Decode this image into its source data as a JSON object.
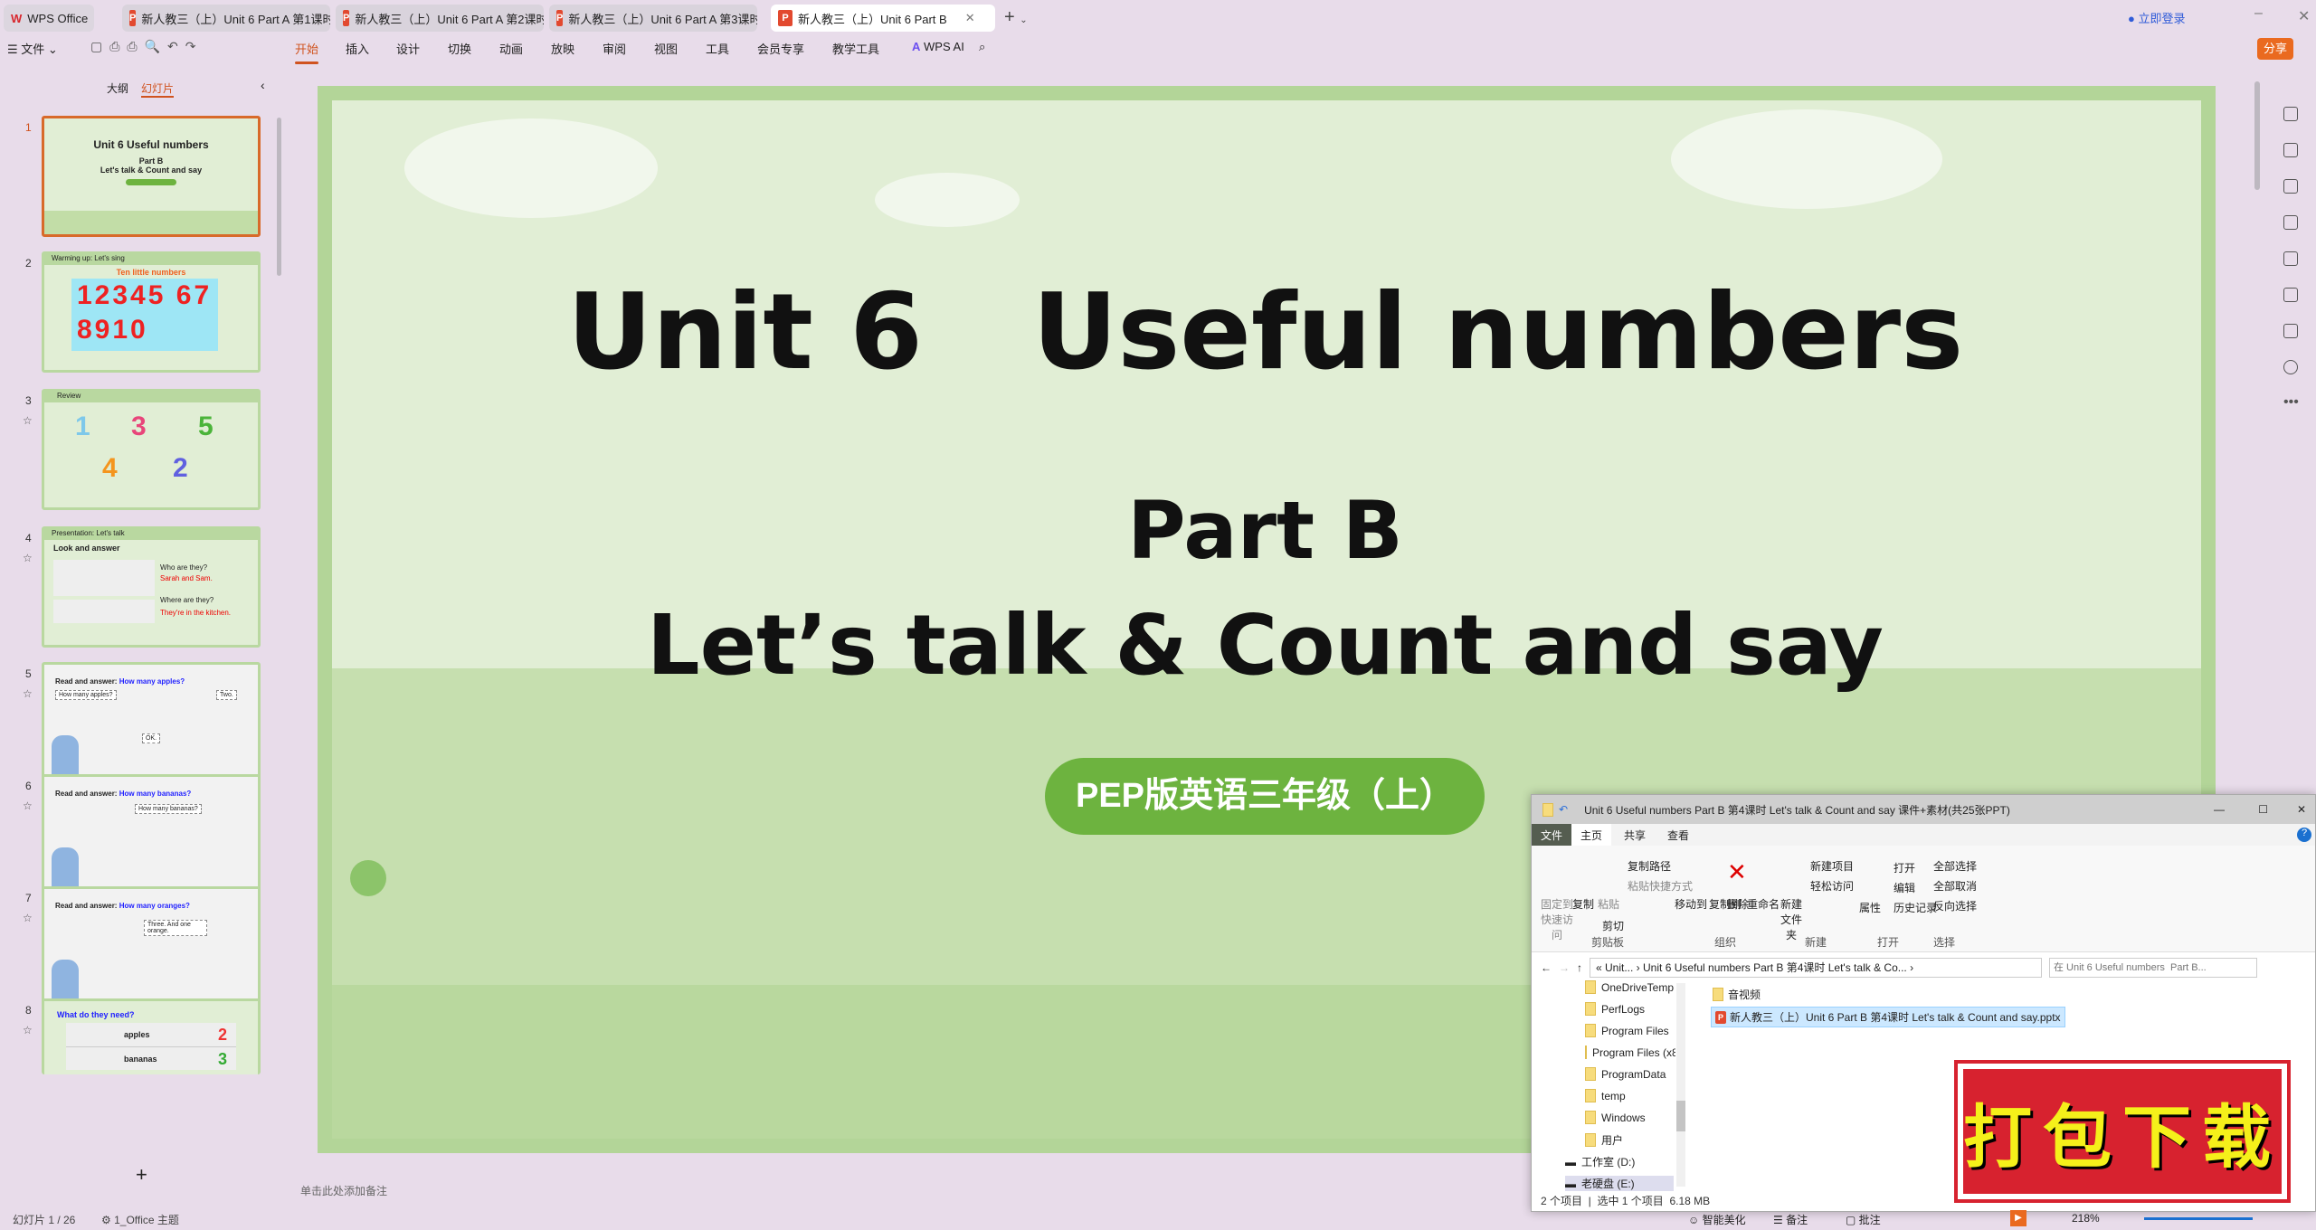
{
  "tabs": [
    {
      "label": "WPS Office"
    },
    {
      "label": "新人教三（上）Unit 6 Part A 第1课时"
    },
    {
      "label": "新人教三（上）Unit 6 Part A 第2课时"
    },
    {
      "label": "新人教三（上）Unit 6 Part A 第3课时"
    },
    {
      "label": "新人教三（上）Unit 6 Part B"
    }
  ],
  "titlebar": {
    "login": "立即登录",
    "share": "分享"
  },
  "menu": {
    "file": "文件",
    "items": [
      "开始",
      "插入",
      "设计",
      "切换",
      "动画",
      "放映",
      "审阅",
      "视图",
      "工具",
      "会员专享",
      "教学工具"
    ],
    "ai": "WPS AI",
    "active": "开始"
  },
  "panel": {
    "outline": "大纲",
    "slides": "幻灯片"
  },
  "thumbnails": [
    {
      "num": "1",
      "title": "Unit 6  Useful numbers",
      "sub1": "Part B",
      "sub2": "Let's talk & Count and say"
    },
    {
      "num": "2",
      "header": "Warming up: Let's sing",
      "title": "Ten little numbers",
      "digits": "12345 678910"
    },
    {
      "num": "3",
      "header": "Review",
      "digits": [
        "1",
        "3",
        "5",
        "4",
        "2"
      ]
    },
    {
      "num": "4",
      "header": "Presentation: Let's talk",
      "title": "Look and answer",
      "q1": "Who are they?",
      "a1": "Sarah and Sam.",
      "q2": "Where are they?",
      "a2": "They're in the kitchen."
    },
    {
      "num": "5",
      "title": "Read and answer:",
      "q": "How many apples?"
    },
    {
      "num": "6",
      "title": "Read and answer:",
      "q": "How many bananas?"
    },
    {
      "num": "7",
      "title": "Read and answer:",
      "q": "How many oranges?"
    },
    {
      "num": "8",
      "title": "What do they need?",
      "rows": [
        {
          "item": "apples",
          "n": "2"
        },
        {
          "item": "bananas",
          "n": "3"
        }
      ]
    }
  ],
  "bubbles": {
    "b1": "How many apples?",
    "b2": "Two.",
    "b3": "How many bananas?",
    "b4": "Three. And one orange.",
    "b5": "OK."
  },
  "slide": {
    "title": "Unit 6   Useful numbers",
    "part": "Part B",
    "subtitle": "Let’s talk & Count and say",
    "badge": "PEP版英语三年级（上）"
  },
  "notes_placeholder": "单击此处添加备注",
  "status": {
    "slide": "幻灯片 1 / 26",
    "theme": "1_Office 主题",
    "beautify": "智能美化",
    "notes": "备注",
    "comments": "批注",
    "zoom": "218%"
  },
  "explorer": {
    "title": "Unit 6 Useful numbers  Part B 第4课时 Let's talk & Count and say 课件+素材(共25张PPT)",
    "tabs": [
      "文件",
      "主页",
      "共享",
      "查看"
    ],
    "ribbon": {
      "clipboard": {
        "label": "剪贴板",
        "pin": "固定到快速访问",
        "copy": "复制",
        "paste": "粘贴",
        "copy_path": "复制路径",
        "paste_shortcut": "粘贴快捷方式",
        "cut": "剪切"
      },
      "organize": {
        "label": "组织",
        "move": "移动到",
        "copyto": "复制到",
        "delete": "删除",
        "rename": "重命名"
      },
      "new": {
        "label": "新建",
        "folder": "新建文件夹",
        "item": "新建项目",
        "easy": "轻松访问"
      },
      "open": {
        "label": "打开",
        "props": "属性",
        "open": "打开",
        "edit": "编辑",
        "history": "历史记录"
      },
      "select": {
        "label": "选择",
        "all": "全部选择",
        "none": "全部取消",
        "invert": "反向选择"
      }
    },
    "address": "«  Unit...  ›  Unit 6 Useful numbers  Part B 第4课时 Let's talk & Co...  ›",
    "search_placeholder": "在 Unit 6 Useful numbers  Part B...",
    "tree": [
      "OneDriveTemp",
      "PerfLogs",
      "Program Files",
      "Program Files (x86)",
      "ProgramData",
      "temp",
      "Windows",
      "用户",
      "工作室 (D:)",
      "老硬盘 (E:)"
    ],
    "files": [
      {
        "name": "音视频",
        "type": "folder"
      },
      {
        "name": "新人教三（上）Unit 6 Part B 第4课时 Let's talk & Count and say.pptx",
        "type": "pptx",
        "selected": true
      }
    ],
    "status": {
      "count": "2 个项目",
      "selected": "选中 1 个项目",
      "size": "6.18 MB"
    }
  },
  "stamp": {
    "text": "打包下载",
    "color": "#d7222f",
    "text_color": "#f5f01a"
  },
  "colors": {
    "accent": "#d0531f",
    "slide_bg": "#e1eed5",
    "badge": "#6db33f",
    "share": "#ea6a1f"
  }
}
